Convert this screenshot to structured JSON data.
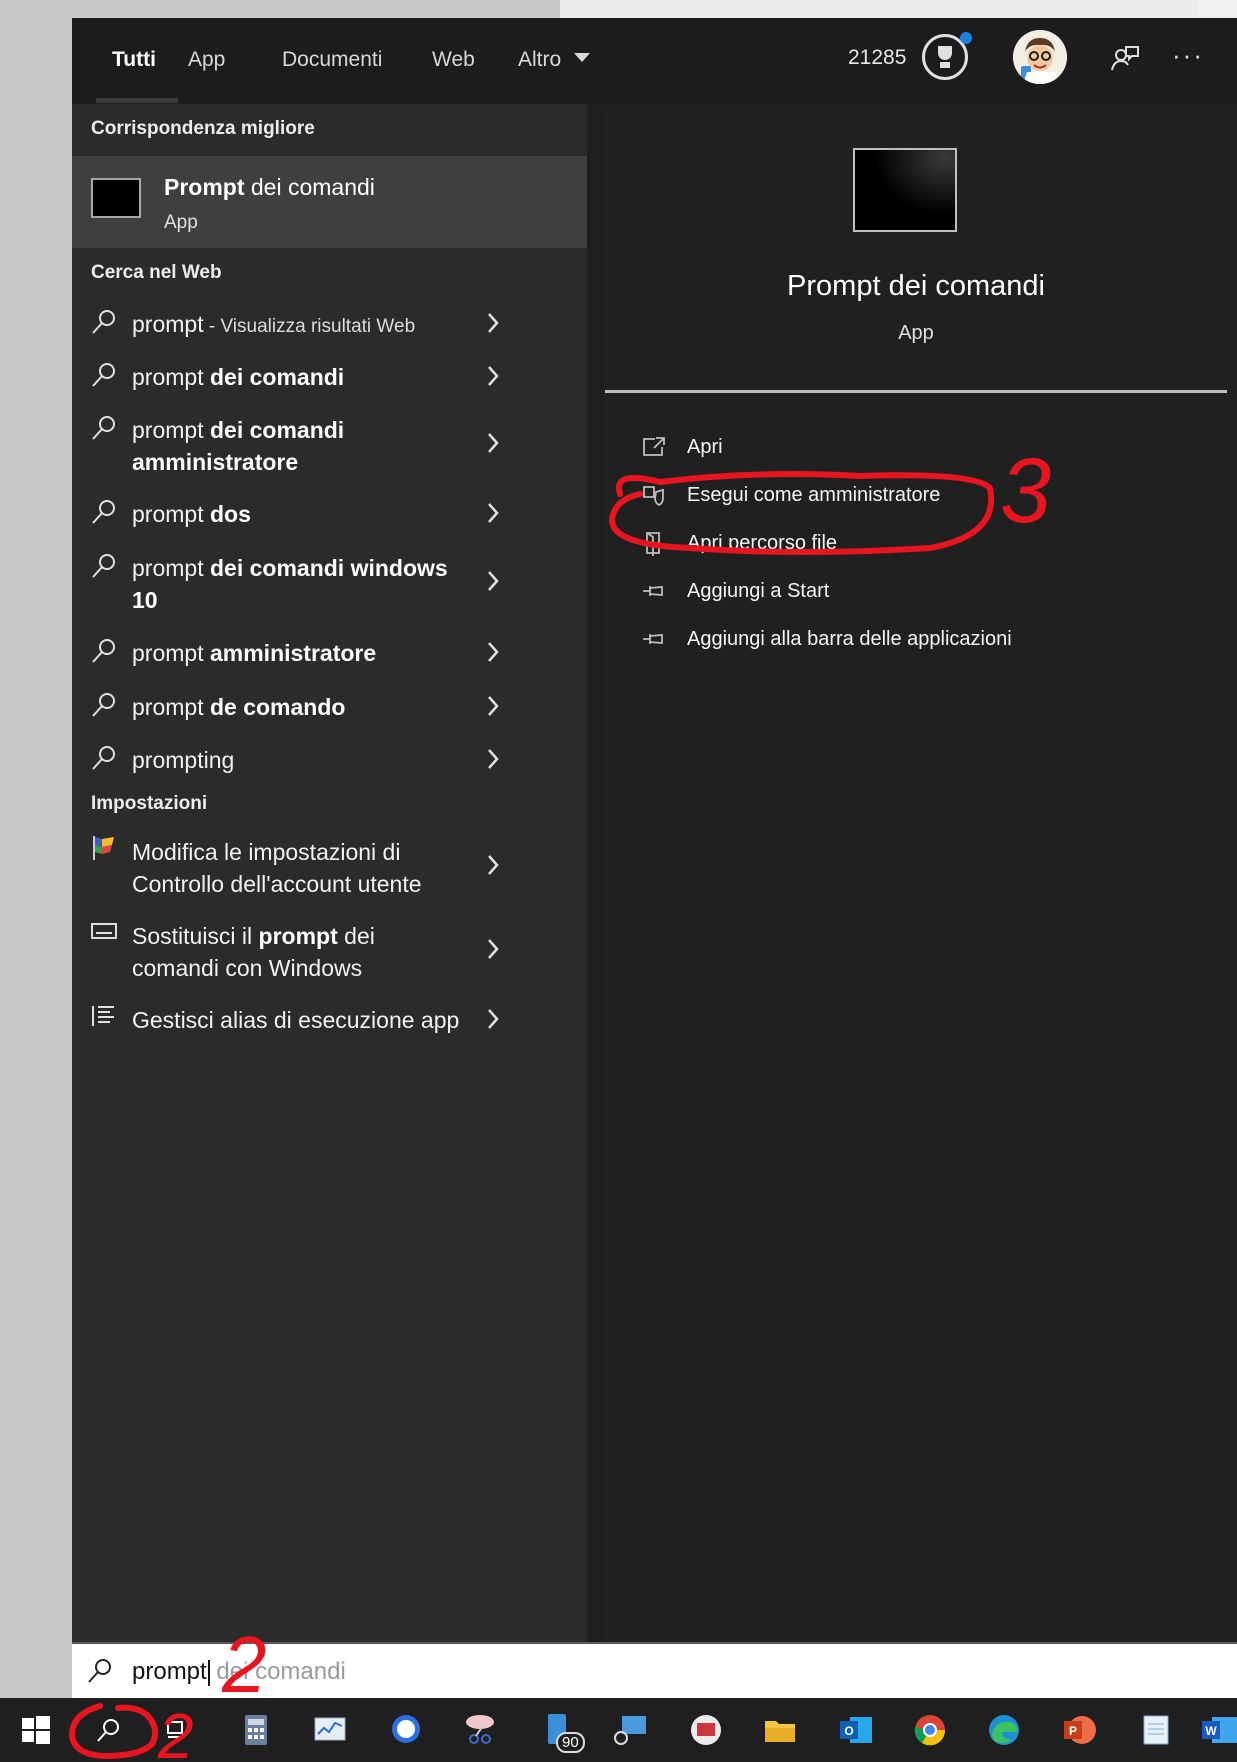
{
  "tabs": [
    {
      "label": "Tutti"
    },
    {
      "label": "App"
    },
    {
      "label": "Documenti"
    },
    {
      "label": "Web"
    },
    {
      "label": "Altro"
    }
  ],
  "rewards_points": "21285",
  "left": {
    "best_match_header": "Corrispondenza migliore",
    "best_match": {
      "title_bold": "Prompt",
      "title_rest": " dei comandi",
      "type": "App"
    },
    "web_header": "Cerca nel Web",
    "web_results": [
      {
        "plain": "prompt",
        "bold": "",
        "hint": " - Visualizza risultati Web"
      },
      {
        "plain": "prompt ",
        "bold": "dei comandi",
        "hint": ""
      },
      {
        "plain": "prompt ",
        "bold": "dei comandi amministratore",
        "hint": ""
      },
      {
        "plain": "prompt ",
        "bold": "dos",
        "hint": ""
      },
      {
        "plain": "prompt ",
        "bold": "dei comandi windows 10",
        "hint": ""
      },
      {
        "plain": "prompt ",
        "bold": "amministratore",
        "hint": ""
      },
      {
        "plain": "prompt ",
        "bold": "de comando",
        "hint": ""
      },
      {
        "plain": "prompting",
        "bold": "",
        "hint": ""
      }
    ],
    "settings_header": "Impostazioni",
    "settings": [
      {
        "text": "Modifica le impostazioni di Controllo dell'account utente",
        "icon": "uac-flag-icon"
      },
      {
        "pre": "Sostituisci il ",
        "bold": "prompt",
        "post": " dei comandi con Windows",
        "icon": "keyboard-icon"
      },
      {
        "text": "Gestisci alias di esecuzione app",
        "icon": "list-icon"
      }
    ]
  },
  "detail": {
    "title": "Prompt dei comandi",
    "subtitle": "App",
    "actions": [
      {
        "label": "Apri",
        "icon": "open-icon"
      },
      {
        "label": "Esegui come amministratore",
        "icon": "shield-icon"
      },
      {
        "label": "Apri percorso file",
        "icon": "file-location-icon"
      },
      {
        "label": "Aggiungi a Start",
        "icon": "pin-icon"
      },
      {
        "label": "Aggiungi alla barra delle applicazioni",
        "icon": "pin-icon"
      }
    ]
  },
  "search": {
    "typed": "prompt",
    "suggestion_rest": "dei comandi"
  },
  "taskbar": {
    "badge": "90"
  },
  "annotations": [
    "2",
    "3"
  ],
  "colors": {
    "flyout_bg": "#1e1e1e",
    "left_bg": "#2b2b2b",
    "best_match_bg": "#3f3f3f",
    "annotation_red": "#e8141f",
    "notification_blue": "#1d7fe6"
  }
}
